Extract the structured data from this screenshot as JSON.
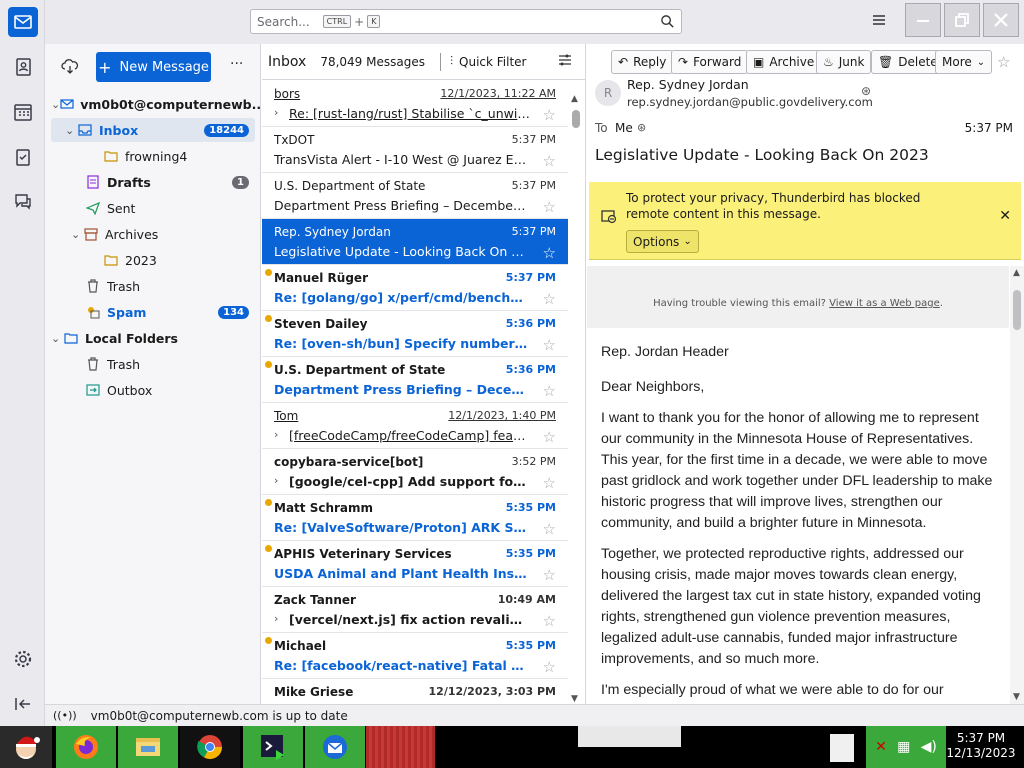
{
  "search": {
    "placeholder": "Search...",
    "key1": "CTRL",
    "key_plus": "+",
    "key2": "K"
  },
  "folder_pane": {
    "new_message": "New Message",
    "account": "vm0b0t@computernewb...",
    "folders": [
      {
        "label": "Inbox",
        "count": "18244"
      },
      {
        "label": "frowning4"
      },
      {
        "label": "Drafts",
        "count": "1"
      },
      {
        "label": "Sent"
      },
      {
        "label": "Archives"
      },
      {
        "label": "2023"
      },
      {
        "label": "Trash"
      },
      {
        "label": "Spam",
        "count": "134"
      },
      {
        "label": "Local Folders"
      },
      {
        "label": "Trash"
      },
      {
        "label": "Outbox"
      }
    ]
  },
  "list": {
    "title": "Inbox",
    "count": "78,049 Messages",
    "quick_filter": "Quick Filter",
    "messages": [
      {
        "from": "bors",
        "date": "12/1/2023, 11:22 AM",
        "subject": "Re: [rust-lang/rust] Stabilise `c_unwind` (..."
      },
      {
        "from": "TxDOT",
        "date": "5:37 PM",
        "subject": "TransVista Alert - I-10 West @ Juarez Exit 2..."
      },
      {
        "from": "U.S. Department of State",
        "date": "5:37 PM",
        "subject": "Department Press Briefing – December 13,..."
      },
      {
        "from": "Rep. Sydney Jordan",
        "date": "5:37 PM",
        "subject": "Legislative Update - Looking Back On 2023"
      },
      {
        "from": "Manuel Rüger",
        "date": "5:37 PM",
        "subject": "Re: [golang/go] x/perf/cmd/benchstat: ..."
      },
      {
        "from": "Steven Dailey",
        "date": "5:36 PM",
        "subject": "Re: [oven-sh/bun] Specify number of h..."
      },
      {
        "from": "U.S. Department of State",
        "date": "5:36 PM",
        "subject": "Department Press Briefing – December ..."
      },
      {
        "from": "Tom",
        "date": "12/1/2023, 1:40 PM",
        "subject": "[freeCodeCamp/freeCodeCamp] feat(cu..."
      },
      {
        "from": "copybara-service[bot]",
        "date": "3:52 PM",
        "subject": "[google/cel-cpp] Add support for jso..."
      },
      {
        "from": "Matt Schramm",
        "date": "5:35 PM",
        "subject": "Re: [ValveSoftware/Proton] ARK Surviva..."
      },
      {
        "from": "APHIS Veterinary Services",
        "date": "5:35 PM",
        "subject": "USDA Animal and Plant Health Inspecti..."
      },
      {
        "from": "Zack Tanner",
        "date": "10:49 AM",
        "subject": "[vercel/next.js] fix action revalidatio..."
      },
      {
        "from": "Michael",
        "date": "5:35 PM",
        "subject": "Re: [facebook/react-native] Fatal Except..."
      },
      {
        "from": "Mike Griese",
        "date": "12/12/2023, 3:03 PM",
        "subject": ""
      }
    ]
  },
  "reader": {
    "buttons": {
      "reply": "Reply",
      "forward": "Forward",
      "archive": "Archive",
      "junk": "Junk",
      "delete": "Delete",
      "more": "More"
    },
    "sender_initial": "R",
    "sender_name": "Rep. Sydney Jordan",
    "sender_email": "rep.sydney.jordan@public.govdelivery.com",
    "to_label": "To",
    "to_value": "Me",
    "time": "5:37 PM",
    "subject": "Legislative Update - Looking Back On 2023",
    "notice": "To protect your privacy, Thunderbird has blocked remote content in this message.",
    "options": "Options",
    "trouble": "Having trouble viewing this email?",
    "trouble_link": "View it as a Web page",
    "trouble_end": ".",
    "header": "Rep. Jordan Header",
    "greeting": "Dear Neighbors,",
    "p1": "I want to thank you for the honor of allowing me to represent our community in the Minnesota House of Representatives. This year, for the first time in a decade, we were able to move past gridlock and work together under DFL leadership to make historic progress that will improve lives, strengthen our community, and build a brighter future in Minnesota.",
    "p2": "Together, we protected reproductive rights, addressed our housing crisis, made major moves towards clean energy, delivered the largest tax cut in state history, expanded voting rights, strengthened gun violence prevention measures, legalized adult-use cannabis, funded major infrastructure improvements, and so much more.",
    "p3": "I'm especially proud of what we were able to do for our"
  },
  "status": {
    "text": "vm0b0t@computernewb.com is up to date"
  },
  "taskbar": {
    "time": "5:37 PM",
    "date": "12/13/2023"
  },
  "colors": {
    "accent": "#0a64d6",
    "notice": "#fbf07a",
    "unread_dot": "#e8a800"
  }
}
